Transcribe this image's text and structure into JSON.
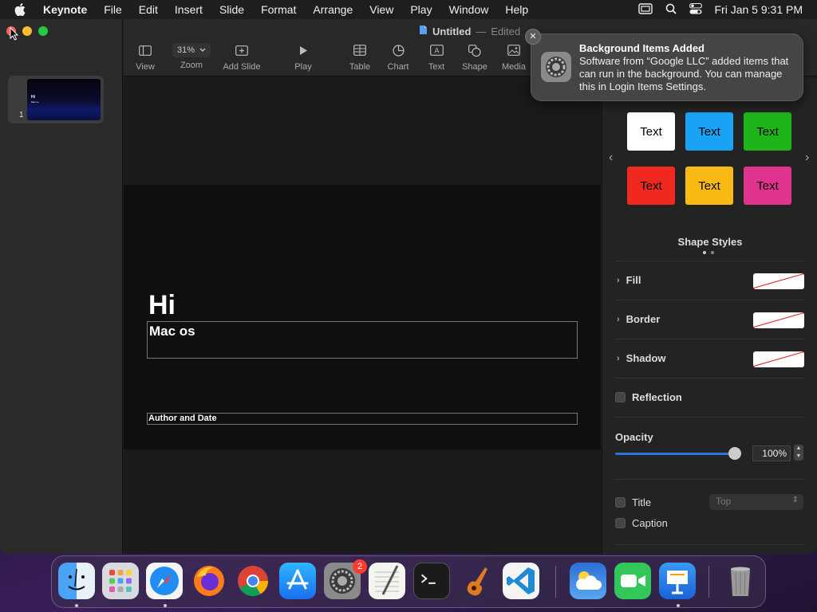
{
  "menubar": {
    "app_name": "Keynote",
    "items": [
      "File",
      "Edit",
      "Insert",
      "Slide",
      "Format",
      "Arrange",
      "View",
      "Play",
      "Window",
      "Help"
    ],
    "clock": "Fri Jan 5  9:31 PM"
  },
  "document": {
    "title": "Untitled",
    "separator": "—",
    "status": "Edited"
  },
  "toolbar": {
    "view": "View",
    "zoom_value": "31%",
    "zoom": "Zoom",
    "add_slide": "Add Slide",
    "play": "Play",
    "table": "Table",
    "chart": "Chart",
    "text": "Text",
    "shape": "Shape",
    "media": "Media"
  },
  "navigator": {
    "slide_number": "1",
    "thumb_title": "Hi",
    "thumb_subtitle": "Mac os"
  },
  "slide": {
    "title": "Hi",
    "subtitle": "Mac os",
    "author": "Author and Date"
  },
  "inspector": {
    "swatches": [
      {
        "label": "Text",
        "bg": "#ffffff",
        "fg": "#000000"
      },
      {
        "label": "Text",
        "bg": "#1aa3f5",
        "fg": "#000000"
      },
      {
        "label": "Text",
        "bg": "#1fb51a",
        "fg": "#000000"
      },
      {
        "label": "Text",
        "bg": "#f0281e",
        "fg": "#000000"
      },
      {
        "label": "Text",
        "bg": "#fbb913",
        "fg": "#000000"
      },
      {
        "label": "Text",
        "bg": "#e0338d",
        "fg": "#000000"
      }
    ],
    "shape_styles": "Shape Styles",
    "fill": "Fill",
    "border": "Border",
    "shadow": "Shadow",
    "reflection": "Reflection",
    "opacity_label": "Opacity",
    "opacity_value": "100%",
    "opacity_level": 1.0,
    "title_label": "Title",
    "title_position": "Top",
    "caption_label": "Caption"
  },
  "notification": {
    "title": "Background Items Added",
    "body": "Software from “Google LLC” added items that can run in the background. You can manage this in Login Items Settings."
  },
  "dock": {
    "apps": [
      "finder-icon",
      "launchpad-icon",
      "safari-icon",
      "firefox-icon",
      "chrome-icon",
      "app-store-icon",
      "system-settings-icon",
      "textedit-icon",
      "terminal-icon",
      "garageband-icon",
      "vscode-icon",
      "weather-icon",
      "facetime-icon",
      "keynote-icon",
      "trash-icon"
    ],
    "settings_badge": "2"
  }
}
